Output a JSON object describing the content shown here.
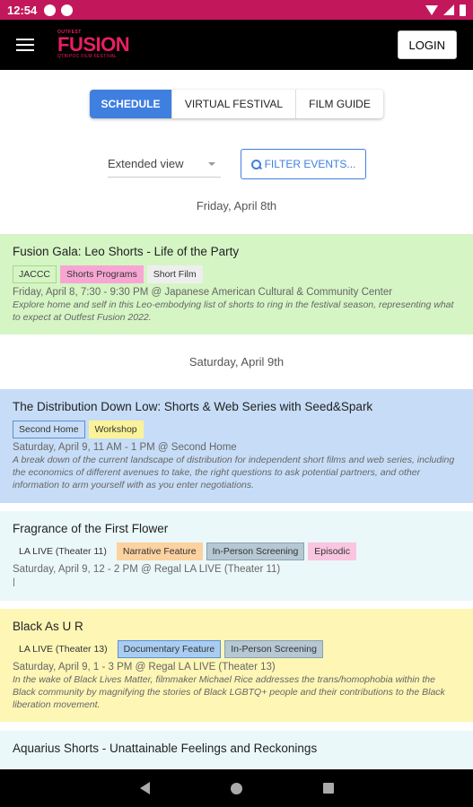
{
  "status_bar": {
    "time": "12:54"
  },
  "header": {
    "logo_small": "OUTFEST",
    "logo_main": "FUSION",
    "logo_sub": "QTBIPOC FILM FESTIVAL",
    "login_label": "LOGIN"
  },
  "tabs": [
    {
      "label": "SCHEDULE",
      "active": true
    },
    {
      "label": "VIRTUAL FESTIVAL",
      "active": false
    },
    {
      "label": "FILM GUIDE",
      "active": false
    }
  ],
  "controls": {
    "view_select_value": "Extended view",
    "filter_label": "FILTER EVENTS..."
  },
  "dates": [
    "Friday, April 8th",
    "Saturday, April 9th"
  ],
  "events": [
    {
      "title": "Fusion Gala: Leo Shorts - Life of the Party",
      "background": "#d5f5c4",
      "tags": [
        {
          "label": "JACCC",
          "bg": "#d5f5c4",
          "border": "#a7d98f"
        },
        {
          "label": "Shorts Programs",
          "bg": "#f7a6d3",
          "border": "#f7a6d3"
        },
        {
          "label": "Short Film",
          "bg": "#eeeeee",
          "border": "#eeeeee"
        }
      ],
      "meta": "Friday, April 8, 7:30 - 9:30 PM @ Japanese American Cultural & Community Center",
      "description": "Explore home and self in this Leo-embodying list of shorts to ring in the festival season, representing what to expect at Outfest Fusion 2022."
    },
    {
      "title": "The Distribution Down Low: Shorts & Web Series with Seed&Spark",
      "background": "#c7ddf7",
      "tags": [
        {
          "label": "Second Home",
          "bg": "#c7ddf7",
          "border": "#5a8fd6"
        },
        {
          "label": "Workshop",
          "bg": "#fbf39a",
          "border": "#fbf39a"
        }
      ],
      "meta": "Saturday, April 9, 11 AM - 1 PM @ Second Home",
      "description": "A break down of the current landscape of distribution for independent short films and web series, including the economics of different avenues to take, the right questions to ask potential partners, and other information to arm yourself with as you enter negotiations."
    },
    {
      "title": "Fragrance of the First Flower",
      "background": "#ebf8fa",
      "tags": [
        {
          "label": "LA LIVE (Theater 11)",
          "bg": "#ebf8fa",
          "border": "#ebf8fa"
        },
        {
          "label": "Narrative Feature",
          "bg": "#fcd2a0",
          "border": "#fcd2a0"
        },
        {
          "label": "In-Person Screening",
          "bg": "#b5c8d3",
          "border": "#8aa1ae"
        },
        {
          "label": "Episodic",
          "bg": "#f9c5e0",
          "border": "#f9c5e0"
        }
      ],
      "meta": "Saturday, April 9, 12 - 2 PM @ Regal LA LIVE (Theater 11)",
      "description": "|"
    },
    {
      "title": "Black As U R",
      "background": "#fdf6b5",
      "tags": [
        {
          "label": "LA LIVE (Theater 13)",
          "bg": "#fdf6b5",
          "border": "#fdf6b5"
        },
        {
          "label": "Documentary Feature",
          "bg": "#a9cdf2",
          "border": "#5a8fd6"
        },
        {
          "label": "In-Person Screening",
          "bg": "#b5c8d3",
          "border": "#8aa1ae"
        }
      ],
      "meta": "Saturday, April 9, 1 - 3 PM @ Regal LA LIVE (Theater 13)",
      "description": "In the wake of Black Lives Matter, filmmaker Michael Rice addresses the trans/homophobia within the Black community by magnifying the stories of Black LGBTQ+ people and their contributions to the Black liberation movement."
    },
    {
      "title": "Aquarius Shorts - Unattainable Feelings and Reckonings",
      "background": "#ebf8fa",
      "tags": [],
      "meta": "",
      "description": ""
    }
  ]
}
